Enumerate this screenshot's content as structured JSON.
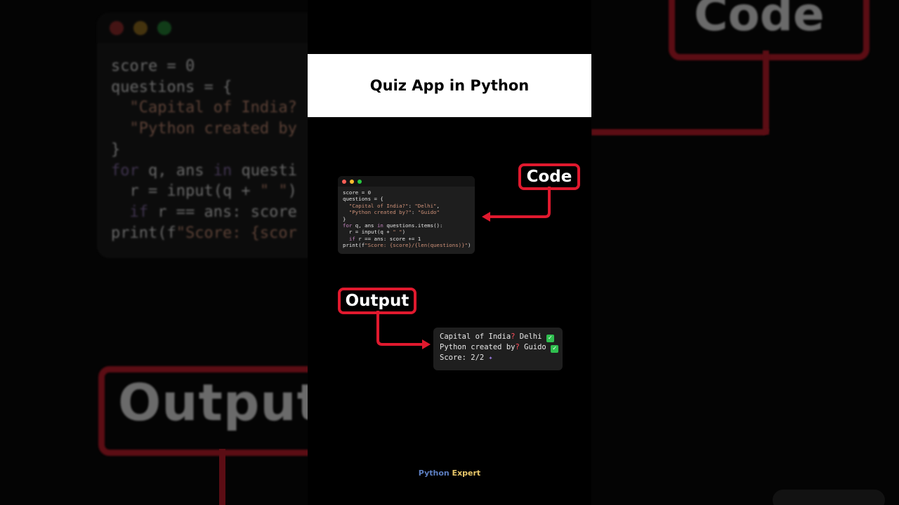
{
  "title": "Quiz App in Python",
  "labels": {
    "code": "Code",
    "output": "Output"
  },
  "code": {
    "window_dots": [
      "#ff5f57",
      "#febc2e",
      "#28c840"
    ],
    "lines": [
      "score = 0",
      "questions = {",
      "  \"Capital of India?\": \"Delhi\",",
      "  \"Python created by?\": \"Guido\"",
      "}",
      "for q, ans in questions.items():",
      "  r = input(q + \" \")",
      "  if r == ans: score += 1",
      "print(f\"Score: {score}/{len(questions)}\")"
    ]
  },
  "output": {
    "lines": [
      {
        "prefix": "Capital of India",
        "mark": "?",
        "suffix": " Delhi ",
        "icon": "check-icon"
      },
      {
        "prefix": "Python created by",
        "mark": "?",
        "suffix": " Guido ",
        "icon": "check-icon"
      },
      {
        "prefix": "Score: 2/2 ",
        "mark": "",
        "suffix": "",
        "icon": "party-popper-icon"
      }
    ]
  },
  "brand": {
    "first": "Python",
    "second": " Expert"
  },
  "background": {
    "code_lines": [
      "score = 0",
      "questions = {",
      "  \"Capital of India?",
      "  \"Python created by",
      "}",
      "for q, ans in questi",
      "  r = input(q + \" \")",
      "  if r == ans: score",
      "print(f\"Score: {scor"
    ],
    "output_text": "Output",
    "code_text": "Code"
  },
  "colors": {
    "accent_red": "#e0192e",
    "title_band": "#ffffff",
    "code_bg": "#1e1e1e",
    "output_bg": "#1f1f1f",
    "brand_blue": "#5d7fc2",
    "brand_yellow": "#e8c76a"
  }
}
